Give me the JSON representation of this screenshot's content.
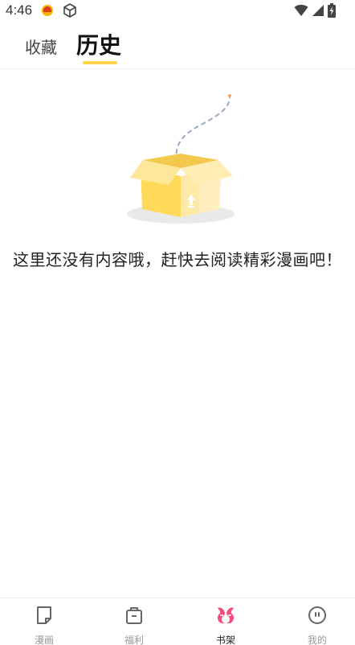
{
  "status_bar": {
    "time": "4:46"
  },
  "tabs": [
    {
      "label": "收藏",
      "active": false
    },
    {
      "label": "历史",
      "active": true
    }
  ],
  "empty_state": {
    "message": "这里还没有内容哦，赶快去阅读精彩漫画吧！"
  },
  "bottom_nav": [
    {
      "label": "漫画",
      "icon": "comic-icon",
      "active": false
    },
    {
      "label": "福利",
      "icon": "gift-bag-icon",
      "active": false
    },
    {
      "label": "书架",
      "icon": "bookshelf-icon",
      "active": true
    },
    {
      "label": "我的",
      "icon": "profile-icon",
      "active": false
    }
  ],
  "colors": {
    "accent_yellow": "#ffd54a",
    "active_nav_pink": "#f24d7a",
    "inactive_gray": "#999999"
  }
}
